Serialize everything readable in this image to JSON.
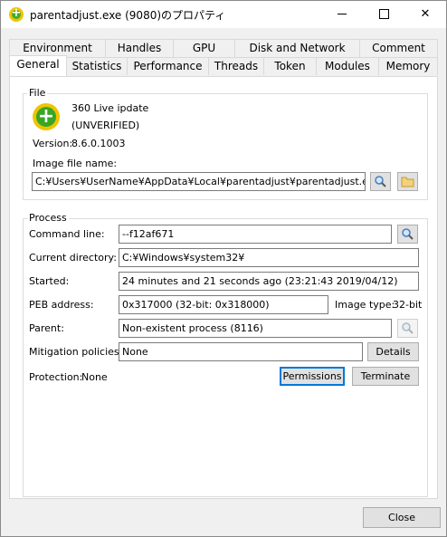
{
  "window": {
    "title": "parentadjust.exe (9080)のプロパティ",
    "minimize_glyph": "",
    "close_glyph": "✕"
  },
  "tabs_top": [
    {
      "label": "Environment"
    },
    {
      "label": "Handles"
    },
    {
      "label": "GPU"
    },
    {
      "label": "Disk and Network"
    },
    {
      "label": "Comment"
    }
  ],
  "tabs_bottom": [
    {
      "label": "General",
      "active": true
    },
    {
      "label": "Statistics"
    },
    {
      "label": "Performance"
    },
    {
      "label": "Threads"
    },
    {
      "label": "Token"
    },
    {
      "label": "Modules"
    },
    {
      "label": "Memory"
    }
  ],
  "file": {
    "group_label": "File",
    "product_name": "360 Live ipdate",
    "verification": "(UNVERIFIED)",
    "version_label": "Version:",
    "version": "8.6.0.1003",
    "image_file_label": "Image file name:",
    "image_file_path": "C:¥Users¥UserName¥AppData¥Local¥parentadjust¥parentadjust.exe"
  },
  "process": {
    "group_label": "Process",
    "command_line_label": "Command line:",
    "command_line": "--f12af671",
    "current_directory_label": "Current directory:",
    "current_directory": "C:¥Windows¥system32¥",
    "started_label": "Started:",
    "started": "24 minutes and 21 seconds ago (23:21:43 2019/04/12)",
    "peb_label": "PEB address:",
    "peb_address": "0x317000 (32-bit: 0x318000)",
    "image_type_label": "Image type:",
    "image_type": "32-bit",
    "parent_label": "Parent:",
    "parent": "Non-existent process (8116)",
    "mitigation_label": "Mitigation policies:",
    "mitigation": "None",
    "details_button": "Details",
    "protection_label": "Protection:",
    "protection": "None",
    "permissions_button": "Permissions",
    "terminate_button": "Terminate"
  },
  "footer": {
    "close_button": "Close"
  }
}
